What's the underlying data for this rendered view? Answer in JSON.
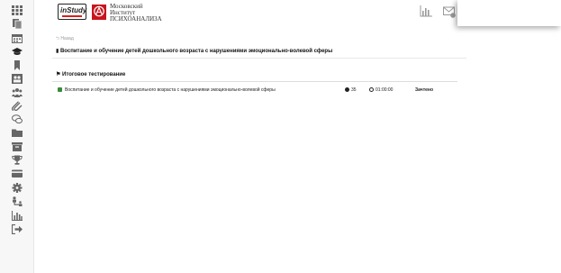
{
  "header": {
    "logo_instudy": "inStudy",
    "institute_lines": [
      "Московский",
      "Институт",
      "ПСИХОАНАЛИЗА"
    ]
  },
  "sidebar": {
    "icons": [
      "grid-icon",
      "documents-icon",
      "calendar-icon",
      "graduation-cap-icon",
      "bookmark-icon",
      "group-icon",
      "paperclip-icon",
      "chat-icon",
      "folder-icon",
      "archive-icon",
      "trophy-icon",
      "credit-card-icon",
      "gear-icon",
      "hierarchy-icon",
      "bar-chart-icon",
      "logout-icon"
    ]
  },
  "content": {
    "back_label": "Назад",
    "course_title": "Воспитание и обучение детей дошкольного возраста с нарушениями эмоционально-волевой сферы",
    "section_title": "Итоговое тестирование",
    "tests": [
      {
        "name": "Воспитание и обучение детей дошкольного возраста с нарушениями эмоционально-волевой сферы",
        "questions": "35",
        "time": "01:00:00",
        "status": "Зачтено"
      }
    ]
  },
  "colors": {
    "brand_red": "#c8141e",
    "check_green": "#3a8a3a",
    "sidebar_bg": "#f7f7f7"
  }
}
